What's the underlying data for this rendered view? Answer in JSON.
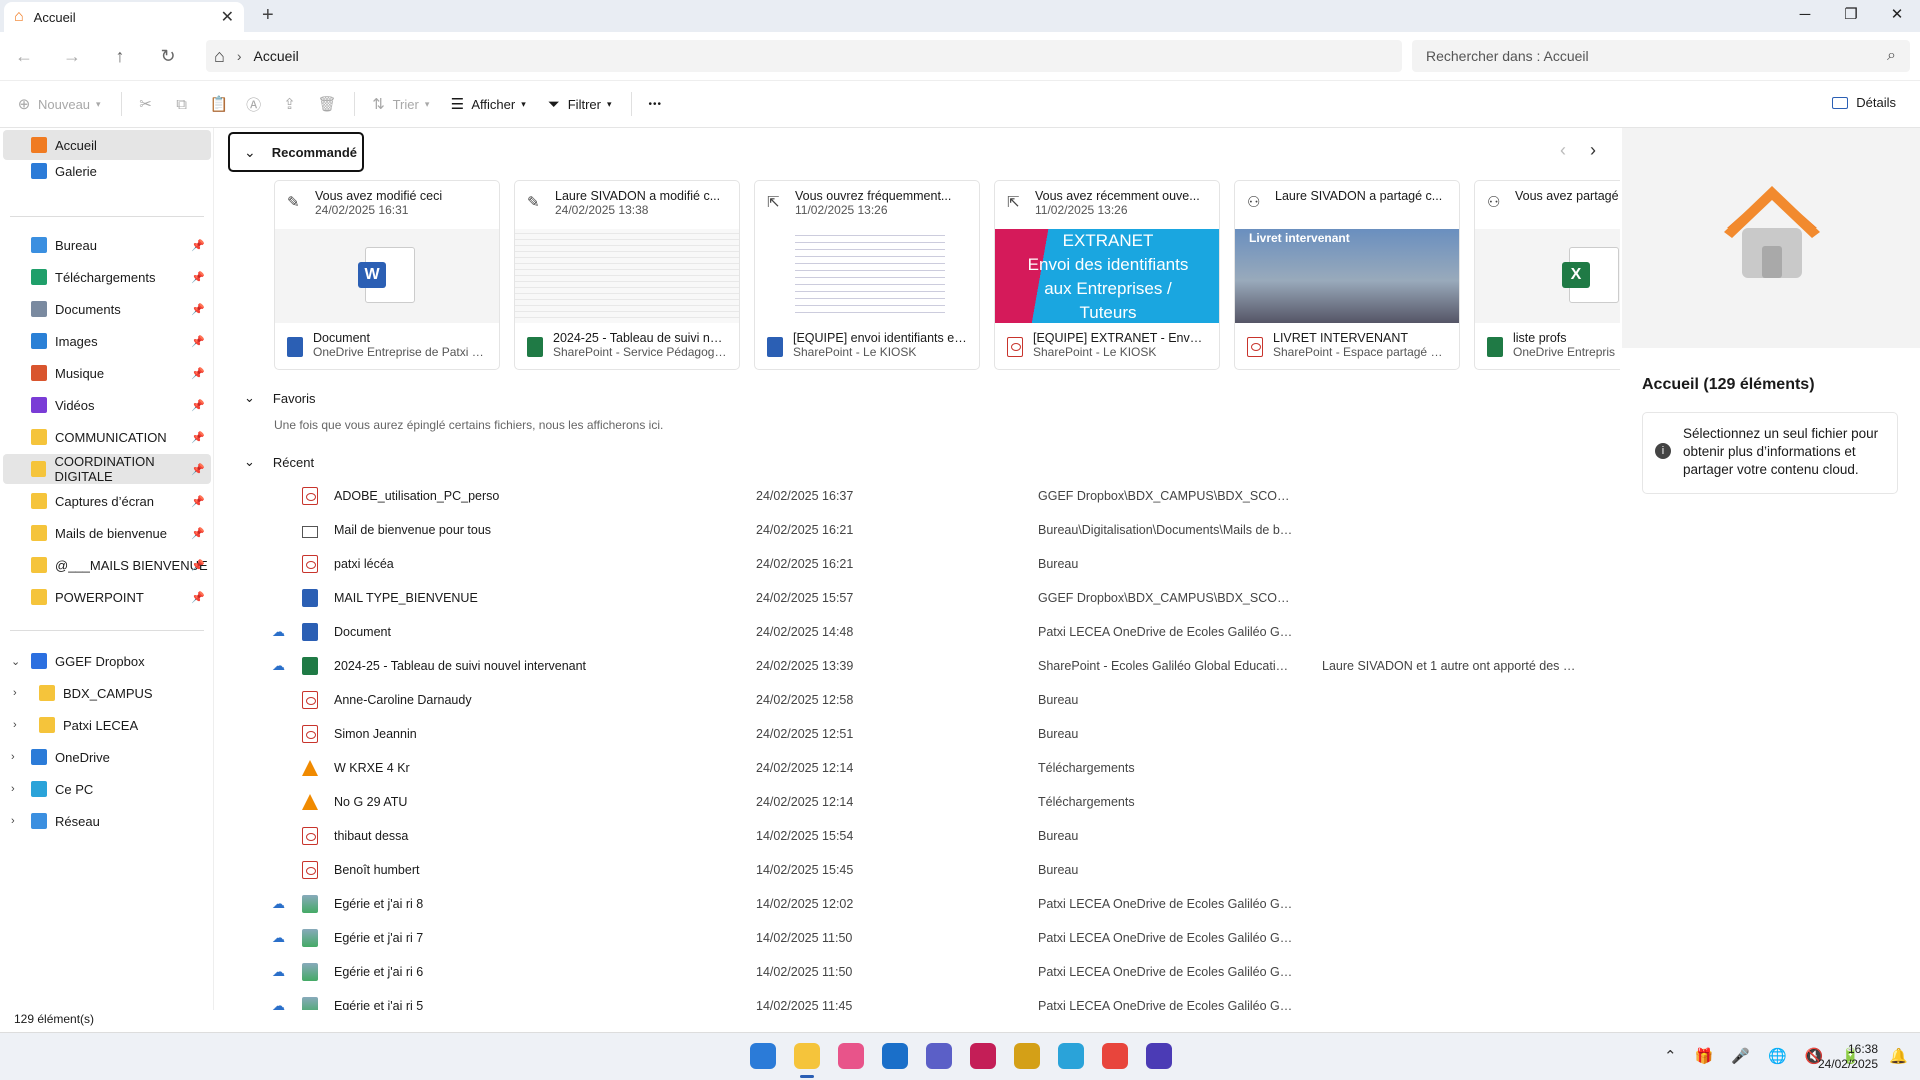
{
  "window": {
    "tab_title": "Accueil",
    "tab_close": "✕",
    "new_tab": "+",
    "minimize": "─",
    "maximize": "❐",
    "close": "✕"
  },
  "nav": {
    "back": "←",
    "forward": "→",
    "up": "↑",
    "refresh": "↻",
    "home_icon": "⌂",
    "breadcrumb_sep": "›",
    "breadcrumb": "Accueil",
    "search_placeholder": "Rechercher dans : Accueil",
    "search_icon": "⌕"
  },
  "toolbar": {
    "new": "Nouveau",
    "sort": "Trier",
    "view": "Afficher",
    "filter": "Filtrer",
    "more": "•••",
    "details": "Détails"
  },
  "sidebar": {
    "top": [
      {
        "label": "Accueil",
        "icon": "home-icon",
        "color": "#f07b22"
      },
      {
        "label": "Galerie",
        "icon": "gallery-icon",
        "color": "#2b7bd8"
      }
    ],
    "quick": [
      {
        "label": "Bureau",
        "icon": "desktop-icon",
        "color": "#3b8fe0"
      },
      {
        "label": "Téléchargements",
        "icon": "download-icon",
        "color": "#1f9f6a"
      },
      {
        "label": "Documents",
        "icon": "documents-icon",
        "color": "#7a8aa0"
      },
      {
        "label": "Images",
        "icon": "images-icon",
        "color": "#2a80d6"
      },
      {
        "label": "Musique",
        "icon": "music-icon",
        "color": "#d9552e"
      },
      {
        "label": "Vidéos",
        "icon": "videos-icon",
        "color": "#7a3cd6"
      },
      {
        "label": "COMMUNICATION",
        "icon": "folder-icon",
        "color": "#f5c43b"
      },
      {
        "label": "COORDINATION DIGITALE",
        "icon": "folder-icon",
        "color": "#f5c43b"
      },
      {
        "label": "Captures d’écran",
        "icon": "folder-icon",
        "color": "#f5c43b"
      },
      {
        "label": "Mails de bienvenue",
        "icon": "folder-icon",
        "color": "#f5c43b"
      },
      {
        "label": "@___MAILS BIENVENUE",
        "icon": "folder-icon",
        "color": "#f5c43b"
      },
      {
        "label": "POWERPOINT",
        "icon": "folder-icon",
        "color": "#f5c43b"
      }
    ],
    "pin": "📌",
    "tree": [
      {
        "label": "GGEF Dropbox",
        "icon": "dropbox-icon",
        "color": "#2b6fe0",
        "chev": "⌄"
      },
      {
        "label": "BDX_CAMPUS",
        "icon": "folder-icon",
        "color": "#f5c43b",
        "chev": "›"
      },
      {
        "label": "Patxi LECEA",
        "icon": "folder-icon",
        "color": "#f5c43b",
        "chev": "›"
      },
      {
        "label": "OneDrive",
        "icon": "cloud-icon",
        "color": "#2b7bd8",
        "chev": "›"
      },
      {
        "label": "Ce PC",
        "icon": "pc-icon",
        "color": "#2aa3d9",
        "chev": "›"
      },
      {
        "label": "Réseau",
        "icon": "network-icon",
        "color": "#3b8fe0",
        "chev": "›"
      }
    ]
  },
  "recommended": {
    "header": "Recommandé",
    "chevron": "⌄",
    "prev": "‹",
    "next": "›",
    "cards": [
      {
        "activity": "Vous avez modifié ceci",
        "date": "24/02/2025 16:31",
        "name": "Document",
        "location": "OneDrive Entreprise de Patxi LE...",
        "activity_icon": "edit-icon",
        "file_icon": "word"
      },
      {
        "activity": "Laure SIVADON a modifié c...",
        "date": "24/02/2025 13:38",
        "name": "2024-25 - Tableau de suivi nou...",
        "location": "SharePoint - Service Pédagogiq...",
        "activity_icon": "edit-icon",
        "file_icon": "xls"
      },
      {
        "activity": "Vous ouvrez fréquemment...",
        "date": "11/02/2025 13:26",
        "name": "[EQUIPE] envoi identifiants ent...",
        "location": "SharePoint - Le KIOSK",
        "activity_icon": "open-icon",
        "file_icon": "word"
      },
      {
        "activity": "Vous avez récemment ouve...",
        "date": "11/02/2025 13:26",
        "name": "[EQUIPE] EXTRANET - Envoi id...",
        "location": "SharePoint - Le KIOSK",
        "activity_icon": "open-icon",
        "file_icon": "pdf",
        "thumb_text": [
          "EXTRANET",
          "Envoi des identifiants",
          "aux Entreprises /",
          "Tuteurs"
        ]
      },
      {
        "activity": "Laure SIVADON a partagé c...",
        "date": "",
        "name": "LIVRET INTERVENANT",
        "location": "SharePoint - Espace partagé Ca...",
        "activity_icon": "share-icon",
        "file_icon": "pdf",
        "thumb_text": [
          "Livret intervenant"
        ]
      },
      {
        "activity": "Vous avez partagé",
        "date": "",
        "name": "liste profs",
        "location": "OneDrive Entrepris",
        "activity_icon": "share-icon",
        "file_icon": "xls"
      }
    ]
  },
  "favorites": {
    "header": "Favoris",
    "hint": "Une fois que vous aurez épinglé certains fichiers, nous les afficherons ici."
  },
  "recent": {
    "header": "Récent",
    "rows": [
      {
        "name": "ADOBE_utilisation_PC_perso",
        "date": "24/02/2025 16:37",
        "location": "GGEF Dropbox\\BDX_CAMPUS\\BDX_SCOLARITE...",
        "activity": "",
        "type": "pdf",
        "cloud": false
      },
      {
        "name": "Mail de bienvenue pour tous",
        "date": "24/02/2025 16:21",
        "location": "Bureau\\Digitalisation\\Documents\\Mails de bie...",
        "activity": "",
        "type": "mail",
        "cloud": false
      },
      {
        "name": "patxi lécéa",
        "date": "24/02/2025 16:21",
        "location": "Bureau",
        "activity": "",
        "type": "pdf",
        "cloud": false
      },
      {
        "name": "MAIL TYPE_BIENVENUE",
        "date": "24/02/2025 15:57",
        "location": "GGEF Dropbox\\BDX_CAMPUS\\BDX_SCOLARITE...",
        "activity": "",
        "type": "word",
        "cloud": false
      },
      {
        "name": "Document",
        "date": "24/02/2025 14:48",
        "location": "Patxi LECEA OneDrive de Ecoles Galiléo Global...",
        "activity": "",
        "type": "word",
        "cloud": true
      },
      {
        "name": "2024-25 - Tableau de suivi nouvel intervenant",
        "date": "24/02/2025 13:39",
        "location": "SharePoint - Ecoles Galiléo Global Education Fr...",
        "activity": "Laure SIVADON et 1 autre ont apporté des mo...",
        "type": "xls",
        "cloud": true
      },
      {
        "name": "Anne-Caroline Darnaudy",
        "date": "24/02/2025 12:58",
        "location": "Bureau",
        "activity": "",
        "type": "pdf",
        "cloud": false
      },
      {
        "name": "Simon Jeannin",
        "date": "24/02/2025 12:51",
        "location": "Bureau",
        "activity": "",
        "type": "pdf",
        "cloud": false
      },
      {
        "name": "W KRXE 4 Kr",
        "date": "24/02/2025 12:14",
        "location": "Téléchargements",
        "activity": "",
        "type": "vlc",
        "cloud": false
      },
      {
        "name": "No G 29 ATU",
        "date": "24/02/2025 12:14",
        "location": "Téléchargements",
        "activity": "",
        "type": "vlc",
        "cloud": false
      },
      {
        "name": "thibaut dessa",
        "date": "14/02/2025 15:54",
        "location": "Bureau",
        "activity": "",
        "type": "pdf",
        "cloud": false
      },
      {
        "name": "Benoît humbert",
        "date": "14/02/2025 15:45",
        "location": "Bureau",
        "activity": "",
        "type": "pdf",
        "cloud": false
      },
      {
        "name": "Egérie et j'ai ri 8",
        "date": "14/02/2025 12:02",
        "location": "Patxi LECEA OneDrive de Ecoles Galiléo Global...",
        "activity": "",
        "type": "img",
        "cloud": true
      },
      {
        "name": "Egérie et j'ai ri 7",
        "date": "14/02/2025 11:50",
        "location": "Patxi LECEA OneDrive de Ecoles Galiléo Global...",
        "activity": "",
        "type": "img",
        "cloud": true
      },
      {
        "name": "Egérie et j'ai ri 6",
        "date": "14/02/2025 11:50",
        "location": "Patxi LECEA OneDrive de Ecoles Galiléo Global...",
        "activity": "",
        "type": "img",
        "cloud": true
      },
      {
        "name": "Egérie et j'ai ri 5",
        "date": "14/02/2025 11:45",
        "location": "Patxi LECEA OneDrive de Ecoles Galiléo Global...",
        "activity": "",
        "type": "img",
        "cloud": true
      }
    ],
    "cloud_icon": "☁"
  },
  "details": {
    "title": "Accueil (129 éléments)",
    "info_icon": "i",
    "message": "Sélectionnez un seul fichier pour obtenir plus d’informations et partager votre contenu cloud."
  },
  "status": "129 élément(s)",
  "taskbar": {
    "apps": [
      {
        "name": "start",
        "color": "#2b7bd8"
      },
      {
        "name": "file-explorer",
        "color": "#f5c43b"
      },
      {
        "name": "photos",
        "color": "#e8548a"
      },
      {
        "name": "outlook",
        "color": "#1a6fc9"
      },
      {
        "name": "teams",
        "color": "#5b5fc7"
      },
      {
        "name": "harvest",
        "color": "#c41e57"
      },
      {
        "name": "pen-tool",
        "color": "#d4a017"
      },
      {
        "name": "snipping-tool",
        "color": "#2aa3d9"
      },
      {
        "name": "chrome",
        "color": "#e8453c"
      },
      {
        "name": "app",
        "color": "#4b3bb5"
      }
    ],
    "tray": [
      "⌃",
      "🎁",
      "🎤",
      "🌐",
      "🔇",
      "🔋"
    ],
    "time": "16:38",
    "date": "24/02/2025",
    "bell": "🔔"
  }
}
